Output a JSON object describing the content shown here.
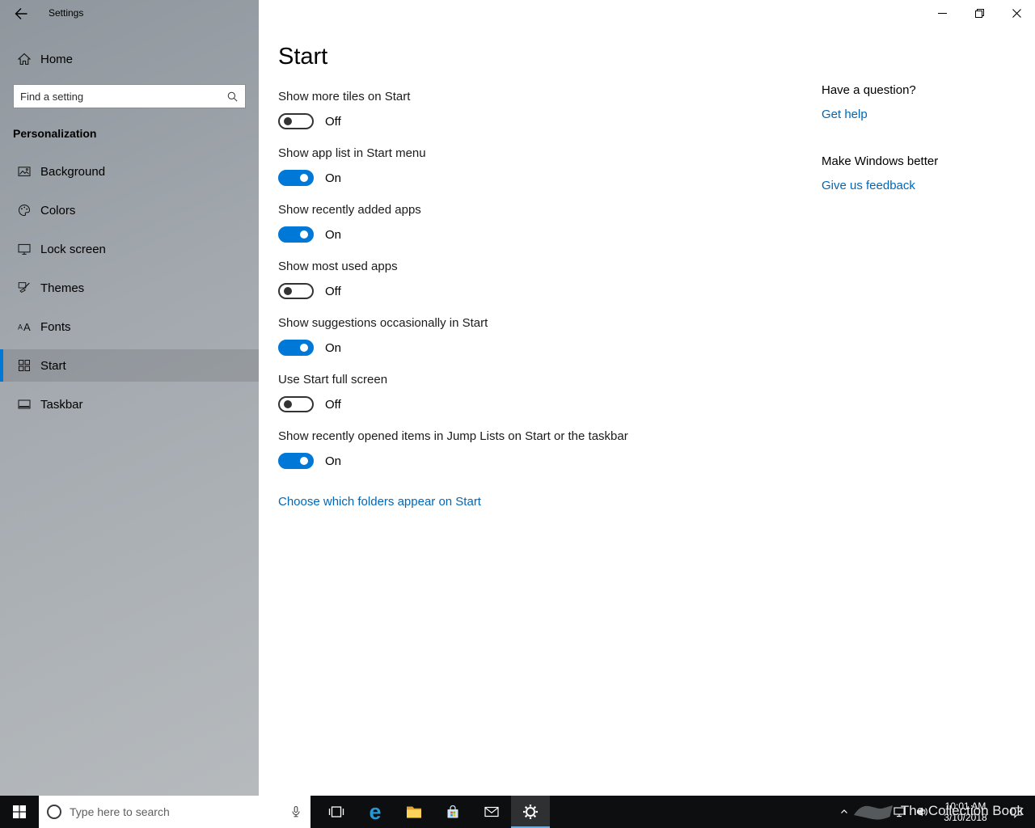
{
  "window": {
    "title": "Settings"
  },
  "sidebar": {
    "home_label": "Home",
    "search_placeholder": "Find a setting",
    "section_header": "Personalization",
    "items": [
      {
        "label": "Background",
        "icon": "image-icon",
        "selected": false
      },
      {
        "label": "Colors",
        "icon": "palette-icon",
        "selected": false
      },
      {
        "label": "Lock screen",
        "icon": "lockscreen-icon",
        "selected": false
      },
      {
        "label": "Themes",
        "icon": "themes-icon",
        "selected": false
      },
      {
        "label": "Fonts",
        "icon": "fonts-icon",
        "selected": false
      },
      {
        "label": "Start",
        "icon": "start-tiles-icon",
        "selected": true
      },
      {
        "label": "Taskbar",
        "icon": "taskbar-icon",
        "selected": false
      }
    ]
  },
  "main": {
    "title": "Start",
    "settings": [
      {
        "label": "Show more tiles on Start",
        "state": "Off",
        "on": false
      },
      {
        "label": "Show app list in Start menu",
        "state": "On",
        "on": true
      },
      {
        "label": "Show recently added apps",
        "state": "On",
        "on": true
      },
      {
        "label": "Show most used apps",
        "state": "Off",
        "on": false
      },
      {
        "label": "Show suggestions occasionally in Start",
        "state": "On",
        "on": true
      },
      {
        "label": "Use Start full screen",
        "state": "Off",
        "on": false
      },
      {
        "label": "Show recently opened items in Jump Lists on Start or the taskbar",
        "state": "On",
        "on": true
      }
    ],
    "folders_link": "Choose which folders appear on Start"
  },
  "help": {
    "question_title": "Have a question?",
    "get_help_link": "Get help",
    "feedback_title": "Make Windows better",
    "feedback_link": "Give us feedback"
  },
  "taskbar": {
    "search_placeholder": "Type here to search",
    "clock_time": "10:01 AM",
    "clock_date": "3/10/2018",
    "watermark": "The Collection Book"
  },
  "colors": {
    "accent": "#0078d7",
    "link": "#0067b8",
    "taskbar_bg": "#0c0e10",
    "toggle_off_border": "#333333"
  }
}
